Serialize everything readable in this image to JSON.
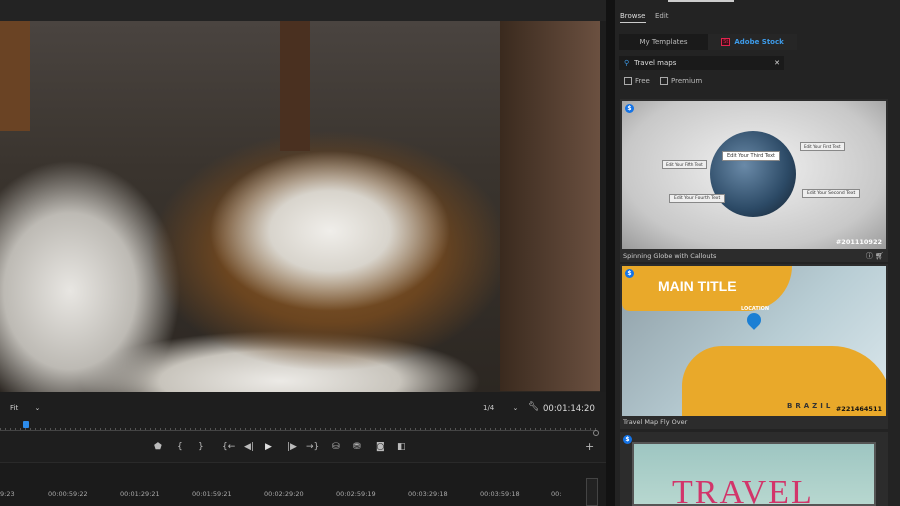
{
  "monitor": {
    "zoom_select": "Fit",
    "resolution_select": "1/4",
    "timecode": "00:01:14:20"
  },
  "transport": [
    "marker",
    "{",
    "}",
    "{←",
    "◀|",
    "▶",
    "|▶",
    "→}",
    "lift",
    "extract",
    "camera",
    "compare"
  ],
  "timeline": {
    "ticks": [
      "9:23",
      "00:00:59:22",
      "00:01:29:21",
      "00:01:59:21",
      "00:02:29:20",
      "00:02:59:19",
      "00:03:29:18",
      "00:03:59:18",
      "00:"
    ]
  },
  "panel": {
    "tabs": [
      "Browse",
      "Edit"
    ],
    "sources": [
      "My Templates",
      "Adobe Stock"
    ],
    "stock_badge": "St",
    "search_value": "Travel maps",
    "filters": [
      "Free",
      "Premium"
    ],
    "results": [
      {
        "title": "Spinning Globe with Callouts",
        "id": "#201110922",
        "callouts": [
          "Edit Your Third Text",
          "Edit Your Fifth Text",
          "Edit Your First Text",
          "Edit Your Fourth Text",
          "Edit Your Second Text"
        ]
      },
      {
        "title": "Travel Map Fly Over",
        "id": "#221464511",
        "main_title": "MAIN TITLE",
        "location": "LOCATION",
        "country": "BRAZIL"
      },
      {
        "title_art": "TRAVEL"
      }
    ]
  },
  "colors": {
    "accent": "#2d8ceb",
    "stock_red": "#e0234e",
    "map_yellow": "#e9a92a"
  }
}
